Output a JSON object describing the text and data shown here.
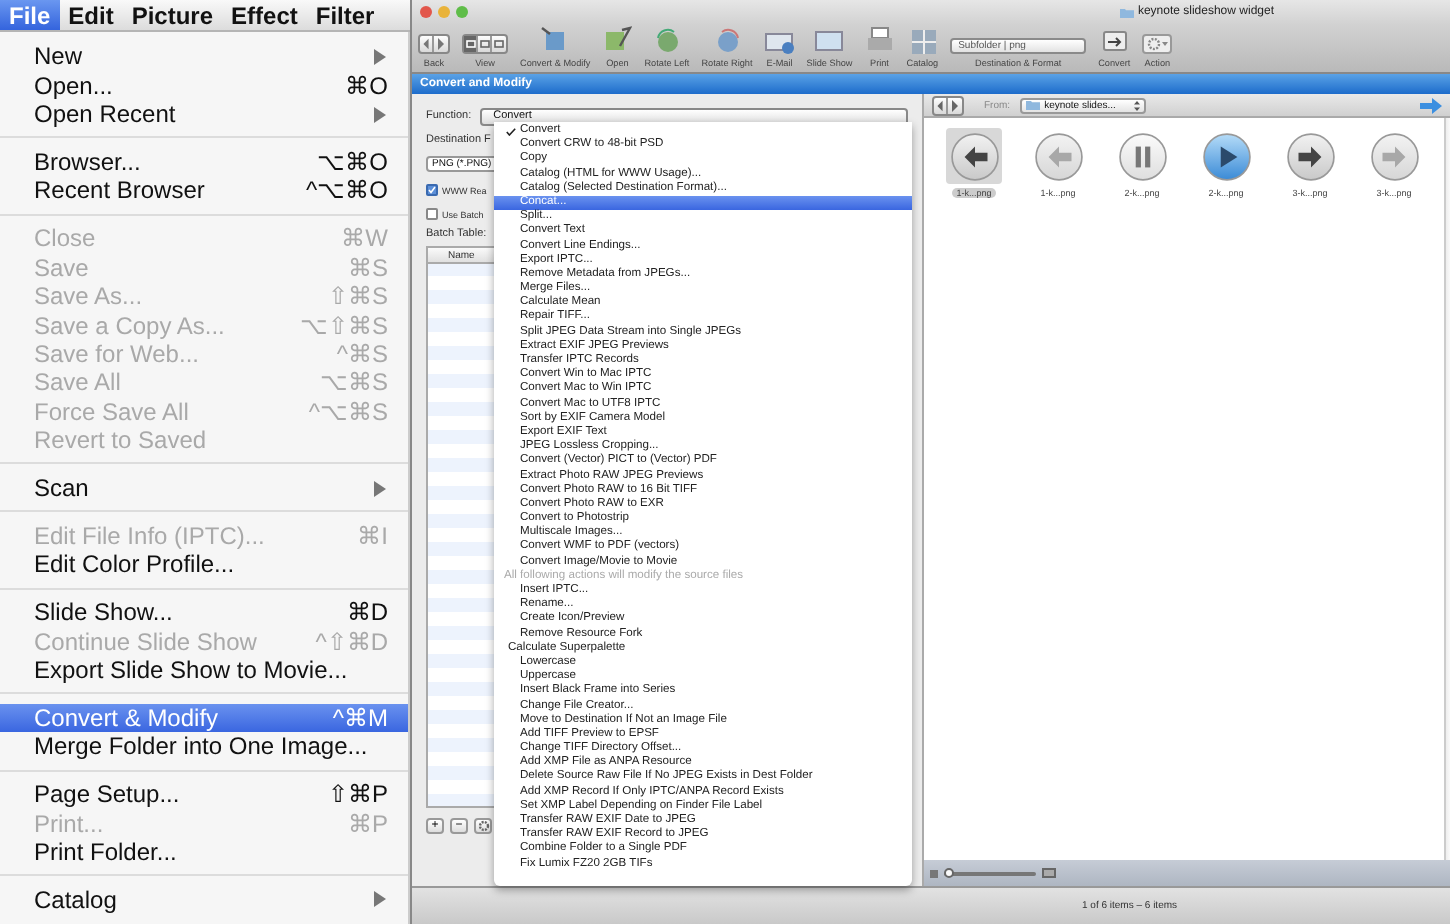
{
  "menu_bar": {
    "items": [
      {
        "label": "File",
        "selected": true
      },
      {
        "label": "Edit",
        "selected": false
      },
      {
        "label": "Picture",
        "selected": false
      },
      {
        "label": "Effect",
        "selected": false
      },
      {
        "label": "Filter",
        "selected": false
      }
    ]
  },
  "file_menu": {
    "groups": [
      [
        {
          "label": "New",
          "disabled": false,
          "selected": false,
          "submenu": true
        },
        {
          "label": "Open...",
          "shortcut": "⌘O",
          "disabled": false,
          "selected": false,
          "submenu": false
        },
        {
          "label": "Open Recent",
          "disabled": false,
          "selected": false,
          "submenu": true
        }
      ],
      [
        {
          "label": "Browser...",
          "shortcut": "⌥⌘O",
          "disabled": false,
          "selected": false,
          "submenu": false
        },
        {
          "label": "Recent Browser",
          "shortcut": "^⌥⌘O",
          "disabled": false,
          "selected": false,
          "submenu": false
        }
      ],
      [
        {
          "label": "Close",
          "shortcut": "⌘W",
          "disabled": true,
          "selected": false,
          "submenu": false
        },
        {
          "label": "Save",
          "shortcut": "⌘S",
          "disabled": true,
          "selected": false,
          "submenu": false
        },
        {
          "label": "Save As...",
          "shortcut": "⇧⌘S",
          "disabled": true,
          "selected": false,
          "submenu": false
        },
        {
          "label": "Save a Copy As...",
          "shortcut": "⌥⇧⌘S",
          "disabled": true,
          "selected": false,
          "submenu": false
        },
        {
          "label": "Save for Web...",
          "shortcut": "^⌘S",
          "disabled": true,
          "selected": false,
          "submenu": false
        },
        {
          "label": "Save All",
          "shortcut": "⌥⌘S",
          "disabled": true,
          "selected": false,
          "submenu": false
        },
        {
          "label": "Force Save All",
          "shortcut": "^⌥⌘S",
          "disabled": true,
          "selected": false,
          "submenu": false
        },
        {
          "label": "Revert to Saved",
          "disabled": true,
          "selected": false,
          "submenu": false
        }
      ],
      [
        {
          "label": "Scan",
          "disabled": false,
          "selected": false,
          "submenu": true
        }
      ],
      [
        {
          "label": "Edit File Info (IPTC)...",
          "shortcut": "⌘I",
          "disabled": true,
          "selected": false,
          "submenu": false
        },
        {
          "label": "Edit Color Profile...",
          "disabled": false,
          "selected": false,
          "submenu": false
        }
      ],
      [
        {
          "label": "Slide Show...",
          "shortcut": "⌘D",
          "disabled": false,
          "selected": false,
          "submenu": false
        },
        {
          "label": "Continue Slide Show",
          "shortcut": "^⇧⌘D",
          "disabled": true,
          "selected": false,
          "submenu": false
        },
        {
          "label": "Export Slide Show to Movie...",
          "disabled": false,
          "selected": false,
          "submenu": false
        }
      ],
      [
        {
          "label": "Convert & Modify",
          "shortcut": "^⌘M",
          "disabled": false,
          "selected": true,
          "submenu": false
        },
        {
          "label": "Merge Folder into One Image...",
          "disabled": false,
          "selected": false,
          "submenu": false
        }
      ],
      [
        {
          "label": "Page Setup...",
          "shortcut": "⇧⌘P",
          "disabled": false,
          "selected": false,
          "submenu": false
        },
        {
          "label": "Print...",
          "shortcut": "⌘P",
          "disabled": true,
          "selected": false,
          "submenu": false
        },
        {
          "label": "Print Folder...",
          "disabled": false,
          "selected": false,
          "submenu": false
        }
      ],
      [
        {
          "label": "Catalog",
          "disabled": false,
          "selected": false,
          "submenu": true
        }
      ]
    ]
  },
  "window": {
    "title": "keynote slideshow widget",
    "toolbar": [
      {
        "kind": "nav",
        "label": "Back"
      },
      {
        "kind": "view",
        "label": "View",
        "segments": [
          {
            "selected": true
          },
          {
            "selected": false
          },
          {
            "selected": false
          }
        ]
      },
      {
        "kind": "tool",
        "label": "Convert & Modify"
      },
      {
        "kind": "tool",
        "label": "Open"
      },
      {
        "kind": "tool",
        "label": "Rotate Left"
      },
      {
        "kind": "tool",
        "label": "Rotate Right"
      },
      {
        "kind": "tool",
        "label": "E-Mail"
      },
      {
        "kind": "tool",
        "label": "Slide Show"
      },
      {
        "kind": "tool",
        "label": "Print"
      },
      {
        "kind": "tool",
        "label": "Catalog"
      },
      {
        "kind": "popup",
        "label": "Destination & Format",
        "value": "Subfolder | png"
      },
      {
        "kind": "tool",
        "label": "Convert"
      },
      {
        "kind": "action",
        "label": "Action"
      }
    ],
    "panel_title": "Convert and Modify"
  },
  "convert_panel": {
    "function_label": "Function:",
    "function_value": "Convert",
    "destination_label": "Destination F",
    "format_value": "PNG (*.PNG)",
    "www_checkbox": {
      "label": "WWW Rea",
      "checked": true
    },
    "batch_checkbox": {
      "label": "Use Batch",
      "checked": false
    },
    "batch_table_label": "Batch Table:",
    "table_columns": [
      "Name"
    ],
    "table_buttons": [
      "+",
      "−"
    ]
  },
  "function_dropdown": {
    "items": [
      {
        "kind": "item",
        "label": "Convert",
        "checked": true,
        "selected": false
      },
      {
        "kind": "item",
        "label": "Convert CRW to 48-bit PSD",
        "checked": false,
        "selected": false
      },
      {
        "kind": "item",
        "label": "Copy",
        "checked": false,
        "selected": false
      },
      {
        "kind": "item",
        "label": "Catalog (HTML for WWW Usage)...",
        "checked": false,
        "selected": false
      },
      {
        "kind": "item",
        "label": "Catalog (Selected Destination Format)...",
        "checked": false,
        "selected": false
      },
      {
        "kind": "item",
        "label": "Concat...",
        "checked": false,
        "selected": true
      },
      {
        "kind": "item",
        "label": "Split...",
        "checked": false,
        "selected": false
      },
      {
        "kind": "item",
        "label": "Convert Text",
        "checked": false,
        "selected": false
      },
      {
        "kind": "item",
        "label": "Convert Line Endings...",
        "checked": false,
        "selected": false
      },
      {
        "kind": "item",
        "label": "Export IPTC...",
        "checked": false,
        "selected": false
      },
      {
        "kind": "item",
        "label": "Remove Metadata from JPEGs...",
        "checked": false,
        "selected": false
      },
      {
        "kind": "item",
        "label": "Merge Files...",
        "checked": false,
        "selected": false
      },
      {
        "kind": "item",
        "label": "Calculate Mean",
        "checked": false,
        "selected": false
      },
      {
        "kind": "item",
        "label": "Repair TIFF...",
        "checked": false,
        "selected": false
      },
      {
        "kind": "item",
        "label": "Split JPEG Data Stream into Single JPEGs",
        "checked": false,
        "selected": false
      },
      {
        "kind": "item",
        "label": "Extract EXIF JPEG Previews",
        "checked": false,
        "selected": false
      },
      {
        "kind": "item",
        "label": "Transfer IPTC Records",
        "checked": false,
        "selected": false
      },
      {
        "kind": "item",
        "label": "Convert Win to Mac IPTC",
        "checked": false,
        "selected": false
      },
      {
        "kind": "item",
        "label": "Convert Mac to Win IPTC",
        "checked": false,
        "selected": false
      },
      {
        "kind": "item",
        "label": "Convert Mac to UTF8 IPTC",
        "checked": false,
        "selected": false
      },
      {
        "kind": "item",
        "label": "Sort by EXIF Camera Model",
        "checked": false,
        "selected": false
      },
      {
        "kind": "item",
        "label": "Export EXIF Text",
        "checked": false,
        "selected": false
      },
      {
        "kind": "item",
        "label": "JPEG Lossless Cropping...",
        "checked": false,
        "selected": false
      },
      {
        "kind": "item",
        "label": "Convert (Vector) PICT to (Vector) PDF",
        "checked": false,
        "selected": false
      },
      {
        "kind": "item",
        "label": "Extract Photo RAW JPEG Previews",
        "checked": false,
        "selected": false
      },
      {
        "kind": "item",
        "label": "Convert Photo RAW to 16 Bit TIFF",
        "checked": false,
        "selected": false
      },
      {
        "kind": "item",
        "label": "Convert Photo RAW to EXR",
        "checked": false,
        "selected": false
      },
      {
        "kind": "item",
        "label": "Convert to Photostrip",
        "checked": false,
        "selected": false
      },
      {
        "kind": "item",
        "label": "Multiscale Images...",
        "checked": false,
        "selected": false
      },
      {
        "kind": "item",
        "label": "Convert WMF to PDF (vectors)",
        "checked": false,
        "selected": false
      },
      {
        "kind": "item",
        "label": "Convert Image/Movie to Movie",
        "checked": false,
        "selected": false
      },
      {
        "kind": "note",
        "label": "All following actions will modify the source files"
      },
      {
        "kind": "item",
        "label": "Insert IPTC...",
        "checked": false,
        "selected": false
      },
      {
        "kind": "item",
        "label": "Rename...",
        "checked": false,
        "selected": false
      },
      {
        "kind": "item",
        "label": "Create Icon/Preview",
        "checked": false,
        "selected": false
      },
      {
        "kind": "item",
        "label": "Remove Resource Fork",
        "checked": false,
        "selected": false
      },
      {
        "kind": "outdent",
        "label": "Calculate Superpalette",
        "checked": false,
        "selected": false
      },
      {
        "kind": "item",
        "label": "Lowercase",
        "checked": false,
        "selected": false
      },
      {
        "kind": "item",
        "label": "Uppercase",
        "checked": false,
        "selected": false
      },
      {
        "kind": "item",
        "label": "Insert Black Frame into Series",
        "checked": false,
        "selected": false
      },
      {
        "kind": "item",
        "label": "Change File Creator...",
        "checked": false,
        "selected": false
      },
      {
        "kind": "item",
        "label": "Move to Destination If Not an Image File",
        "checked": false,
        "selected": false
      },
      {
        "kind": "item",
        "label": "Add TIFF Preview to EPSF",
        "checked": false,
        "selected": false
      },
      {
        "kind": "item",
        "label": "Change TIFF Directory Offset...",
        "checked": false,
        "selected": false
      },
      {
        "kind": "item",
        "label": "Add XMP File as ANPA Resource",
        "checked": false,
        "selected": false
      },
      {
        "kind": "item",
        "label": "Delete Source Raw File If No JPEG Exists in Dest Folder",
        "checked": false,
        "selected": false
      },
      {
        "kind": "item",
        "label": "Add XMP Record If Only IPTC/ANPA Record Exists",
        "checked": false,
        "selected": false
      },
      {
        "kind": "item",
        "label": "Set XMP Label Depending on Finder File Label",
        "checked": false,
        "selected": false
      },
      {
        "kind": "item",
        "label": "Transfer RAW EXIF Date to JPEG",
        "checked": false,
        "selected": false
      },
      {
        "kind": "item",
        "label": "Transfer RAW EXIF Record to JPEG",
        "checked": false,
        "selected": false
      },
      {
        "kind": "item",
        "label": "Combine Folder to a Single PDF",
        "checked": false,
        "selected": false
      },
      {
        "kind": "item",
        "label": "Fix Lumix FZ20 2GB TIFs",
        "checked": false,
        "selected": false
      }
    ]
  },
  "browser": {
    "from_label": "From:",
    "folder": "keynote slides...",
    "thumbnails": [
      {
        "kind": "back",
        "dimmed": false,
        "label": "1-k...png",
        "selected": true
      },
      {
        "kind": "back",
        "dimmed": true,
        "label": "1-k...png",
        "selected": false
      },
      {
        "kind": "pause",
        "dimmed": false,
        "label": "2-k...png",
        "selected": false
      },
      {
        "kind": "play",
        "dimmed": false,
        "label": "2-k...png",
        "selected": false
      },
      {
        "kind": "forward",
        "dimmed": false,
        "label": "3-k...png",
        "selected": false
      },
      {
        "kind": "forward",
        "dimmed": true,
        "label": "3-k...png",
        "selected": false
      }
    ],
    "zoom_slider": {
      "level": 0.05
    }
  },
  "status_bar": {
    "text": "1 of 6 items – 6 items"
  }
}
